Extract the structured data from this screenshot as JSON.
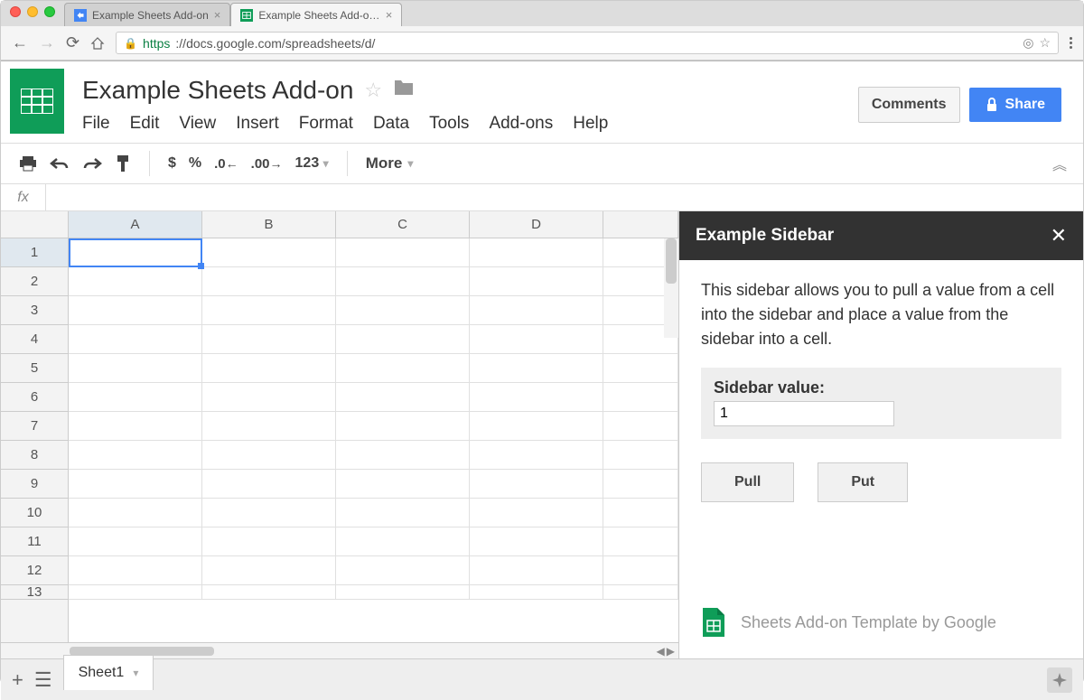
{
  "browser": {
    "tabs": [
      {
        "label": "Example Sheets Add-on",
        "active": false
      },
      {
        "label": "Example Sheets Add-on - Goo",
        "active": true
      }
    ],
    "url_scheme": "https",
    "url_rest": "://docs.google.com/spreadsheets/d/"
  },
  "doc": {
    "title": "Example Sheets Add-on"
  },
  "menubar": [
    "File",
    "Edit",
    "View",
    "Insert",
    "Format",
    "Data",
    "Tools",
    "Add-ons",
    "Help"
  ],
  "header_buttons": {
    "comments": "Comments",
    "share": "Share"
  },
  "toolbar": {
    "currency": "$",
    "percent": "%",
    "dec_minus": ".0",
    "dec_plus": ".00",
    "format_num": "123",
    "more": "More"
  },
  "grid": {
    "columns": [
      "A",
      "B",
      "C",
      "D"
    ],
    "rows": [
      "1",
      "2",
      "3",
      "4",
      "5",
      "6",
      "7",
      "8",
      "9",
      "10",
      "11",
      "12",
      "13"
    ],
    "selected": "A1"
  },
  "sheet_tabs": {
    "active": "Sheet1"
  },
  "sidebar": {
    "title": "Example Sidebar",
    "description": "This sidebar allows you to pull a value from a cell into the sidebar and place a value from the sidebar into a cell.",
    "field_label": "Sidebar value:",
    "field_value": "1",
    "pull": "Pull",
    "put": "Put",
    "footer": "Sheets Add-on Template by Google"
  }
}
